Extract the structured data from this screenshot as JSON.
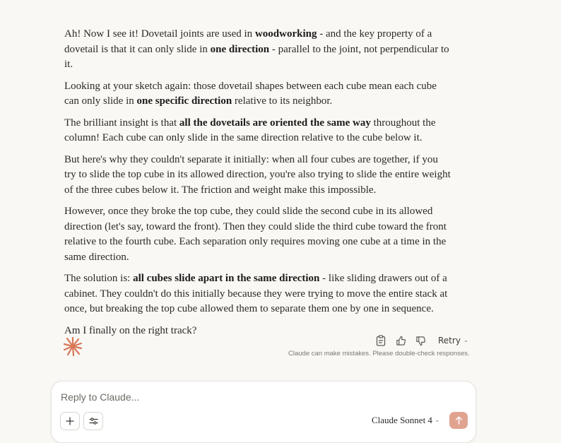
{
  "message": {
    "p1": {
      "a": "Ah! Now I see it! Dovetail joints are used in ",
      "b": "woodworking",
      "c": " - and the key property of a dovetail is that it can only slide in ",
      "d": "one direction",
      "e": " - parallel to the joint, not perpendicular to it."
    },
    "p2": {
      "a": "Looking at your sketch again: those dovetail shapes between each cube mean each cube can only slide in ",
      "b": "one specific direction",
      "c": " relative to its neighbor."
    },
    "p3": {
      "a": "The brilliant insight is that ",
      "b": "all the dovetails are oriented the same way",
      "c": " throughout the column! Each cube can only slide in the same direction relative to the cube below it."
    },
    "p4": "But here's why they couldn't separate it initially: when all four cubes are together, if you try to slide the top cube in its allowed direction, you're also trying to slide the entire weight of the three cubes below it. The friction and weight make this impossible.",
    "p5": "However, once they broke the top cube, they could slide the second cube in its allowed direction (let's say, toward the front). Then they could slide the third cube toward the front relative to the fourth cube. Each separation only requires moving one cube at a time in the same direction.",
    "p6": {
      "a": "The solution is: ",
      "b": "all cubes slide apart in the same direction",
      "c": " - like sliding drawers out of a cabinet. They couldn't do this initially because they were trying to move the entire stack at once, but breaking the top cube allowed them to separate them one by one in sequence."
    },
    "p7": "Am I finally on the right track?"
  },
  "actions": {
    "copy_icon": "clipboard-icon",
    "like_icon": "thumbs-up-icon",
    "dislike_icon": "thumbs-down-icon",
    "retry_label": "Retry"
  },
  "disclaimer": "Claude can make mistakes. Please double-check responses.",
  "composer": {
    "placeholder": "Reply to Claude...",
    "model_label": "Claude Sonnet 4"
  },
  "colors": {
    "accent": "#d97757",
    "send_bg": "#e0a390",
    "background": "#f9f8f5"
  }
}
